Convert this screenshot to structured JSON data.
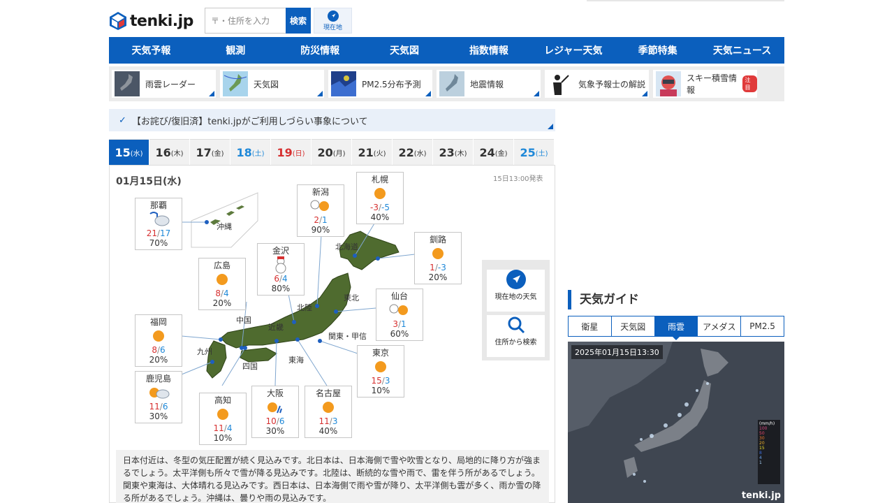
{
  "header": {
    "logo_text": "tenki.jp",
    "search_placeholder": "〒・住所を入力",
    "search_button": "検索",
    "current_location": "現在地"
  },
  "nav": [
    "天気予報",
    "観測",
    "防災情報",
    "天気図",
    "指数情報",
    "レジャー天気",
    "季節特集",
    "天気ニュース"
  ],
  "subnav": [
    {
      "label": "雨雲レーダー",
      "tag": ""
    },
    {
      "label": "天気図",
      "tag": ""
    },
    {
      "label": "PM2.5分布予測",
      "tag": ""
    },
    {
      "label": "地震情報",
      "tag": ""
    },
    {
      "label": "気象予報士の解説",
      "tag": ""
    },
    {
      "label": "スキー積雪情報",
      "tag": "注目"
    }
  ],
  "notice": "【お詫び/復旧済】tenki.jpがご利用しづらい事象について",
  "date_tabs": [
    {
      "day": "15",
      "dow": "(水)",
      "type": "selected"
    },
    {
      "day": "16",
      "dow": "(木)",
      "type": "weekday"
    },
    {
      "day": "17",
      "dow": "(金)",
      "type": "weekday"
    },
    {
      "day": "18",
      "dow": "(土)",
      "type": "sat"
    },
    {
      "day": "19",
      "dow": "(日)",
      "type": "sun"
    },
    {
      "day": "20",
      "dow": "(月)",
      "type": "weekday"
    },
    {
      "day": "21",
      "dow": "(火)",
      "type": "weekday"
    },
    {
      "day": "22",
      "dow": "(水)",
      "type": "weekday"
    },
    {
      "day": "23",
      "dow": "(木)",
      "type": "weekday"
    },
    {
      "day": "24",
      "dow": "(金)",
      "type": "weekday"
    },
    {
      "day": "25",
      "dow": "(土)",
      "type": "sat"
    }
  ],
  "map": {
    "date": "01月15日(水)",
    "issued": "15日13:00発表",
    "regions": [
      "沖縄",
      "北海道",
      "東北",
      "北陸",
      "中国",
      "近畿",
      "関東・甲信",
      "九州",
      "四国",
      "東海"
    ]
  },
  "cities": [
    {
      "name": "那覇",
      "hi": "21",
      "lo": "17",
      "pop": "70%",
      "icon": "rain-cloud-icon"
    },
    {
      "name": "新潟",
      "hi": "2",
      "lo": "1",
      "pop": "90%",
      "icon": "snow-sun-icon"
    },
    {
      "name": "札幌",
      "hi": "-3",
      "lo": "-5",
      "pop": "40%",
      "icon": "sun-icon"
    },
    {
      "name": "金沢",
      "hi": "6",
      "lo": "4",
      "pop": "80%",
      "icon": "snow-icon"
    },
    {
      "name": "釧路",
      "hi": "1",
      "lo": "-3",
      "pop": "20%",
      "icon": "sun-icon"
    },
    {
      "name": "広島",
      "hi": "8",
      "lo": "4",
      "pop": "20%",
      "icon": "sun-icon"
    },
    {
      "name": "仙台",
      "hi": "3",
      "lo": "1",
      "pop": "60%",
      "icon": "snow-sun-icon"
    },
    {
      "name": "福岡",
      "hi": "8",
      "lo": "6",
      "pop": "20%",
      "icon": "sun-icon"
    },
    {
      "name": "東京",
      "hi": "15",
      "lo": "3",
      "pop": "10%",
      "icon": "sun-icon"
    },
    {
      "name": "鹿児島",
      "hi": "11",
      "lo": "6",
      "pop": "30%",
      "icon": "sun-cloud-icon"
    },
    {
      "name": "高知",
      "hi": "11",
      "lo": "4",
      "pop": "10%",
      "icon": "sun-icon"
    },
    {
      "name": "大阪",
      "hi": "10",
      "lo": "6",
      "pop": "30%",
      "icon": "sun-rain-icon"
    },
    {
      "name": "名古屋",
      "hi": "11",
      "lo": "3",
      "pop": "40%",
      "icon": "sun-icon"
    }
  ],
  "side_buttons": {
    "current": "現在地の天気",
    "search": "住所から検索"
  },
  "description": "日本付近は、冬型の気圧配置が続く見込みです。北日本は、日本海側で雪や吹雪となり、局地的に降り方が強まるでしょう。太平洋側も所々で雪が降る見込みです。北陸は、断続的な雪や雨で、雷を伴う所があるでしょう。関東や東海は、大体晴れる見込みです。西日本は、日本海側で雨や雪が降り、太平洋側も雲が多く、雨か雪の降る所があるでしょう。沖縄は、曇りや雨の見込みです。",
  "guide": {
    "title": "天気ガイド",
    "tabs": [
      "衛星",
      "天気図",
      "雨雲",
      "アメダス",
      "PM2.5"
    ],
    "selected_tab": "雨雲",
    "timestamp": "2025年01月15日13:30",
    "brand": "tenki.jp",
    "legend_unit": "(mm/h)",
    "legend_values": [
      "100",
      "50",
      "30",
      "20",
      "15",
      "8",
      "4",
      "1"
    ]
  },
  "colors": {
    "brand_blue": "#0b5fbd",
    "hi_red": "#d63030",
    "lo_blue": "#1e88d8",
    "sun_orange": "#f39a1e"
  }
}
